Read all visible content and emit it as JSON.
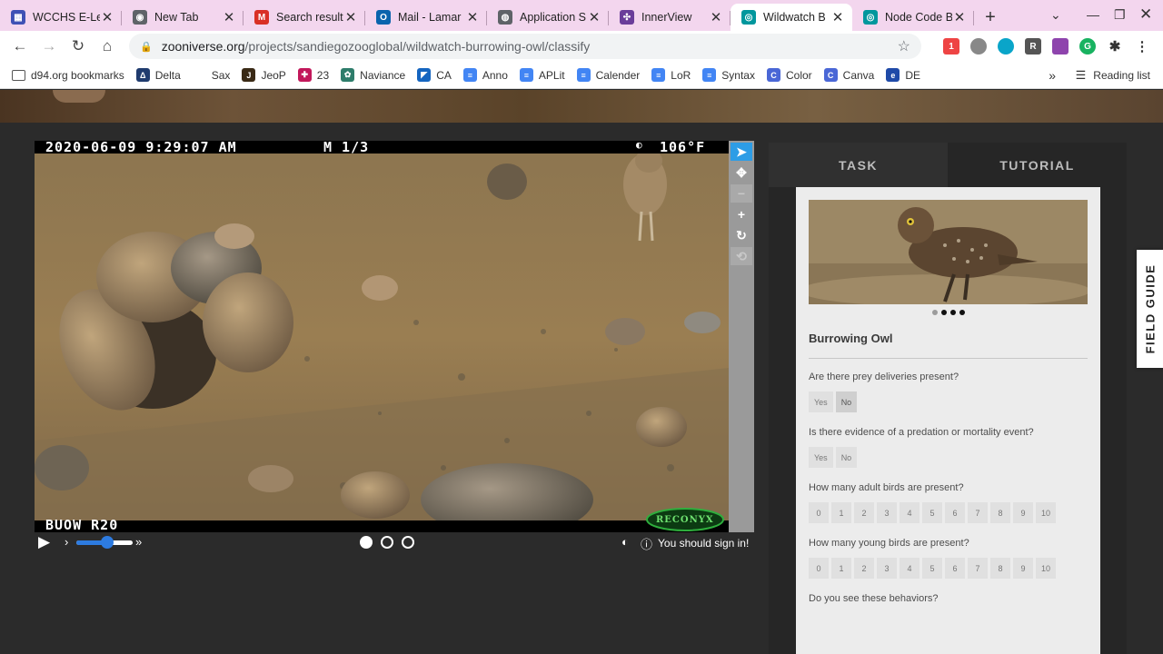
{
  "browser": {
    "tabs": [
      {
        "title": "WCCHS E-Le",
        "icon": "calendar-icon",
        "color": "#3f51b5"
      },
      {
        "title": "New Tab",
        "icon": "chrome-icon",
        "color": "#5f6368"
      },
      {
        "title": "Search result",
        "icon": "gmail-icon",
        "color": "#d93025"
      },
      {
        "title": "Mail - Lamar",
        "icon": "outlook-icon",
        "color": "#0a64ad"
      },
      {
        "title": "Application S",
        "icon": "globe-icon",
        "color": "#5f6368"
      },
      {
        "title": "InnerView",
        "icon": "innerview-icon",
        "color": "#6a3d9a"
      },
      {
        "title": "Wildwatch B",
        "icon": "zooniverse-icon",
        "color": "#00979d",
        "active": true
      },
      {
        "title": "Node Code B",
        "icon": "zooniverse-icon",
        "color": "#00979d"
      }
    ],
    "url_host": "zooniverse.org",
    "url_path": "/projects/sandiegozooglobal/wildwatch-burrowing-owl/classify",
    "bookmarks": [
      {
        "label": "d94.org bookmarks",
        "icon": "folder-icon",
        "color": "#555555"
      },
      {
        "label": "Delta",
        "icon": "delta-icon",
        "color": "#1f3b6e"
      },
      {
        "label": "Sax",
        "icon": "blank-icon",
        "color": "#ffffff"
      },
      {
        "label": "JeoP",
        "icon": "jeopardy-icon",
        "color": "#3a2a16"
      },
      {
        "label": "23",
        "icon": "23andme-icon",
        "color": "#c2185b"
      },
      {
        "label": "Naviance",
        "icon": "naviance-icon",
        "color": "#2e7d6b"
      },
      {
        "label": "CA",
        "icon": "commonapp-icon",
        "color": "#1565c0"
      },
      {
        "label": "Anno",
        "icon": "docs-icon",
        "color": "#4285f4"
      },
      {
        "label": "APLit",
        "icon": "docs-icon",
        "color": "#4285f4"
      },
      {
        "label": "Calender",
        "icon": "docs-icon",
        "color": "#4285f4"
      },
      {
        "label": "LoR",
        "icon": "docs-icon",
        "color": "#4285f4"
      },
      {
        "label": "Syntax",
        "icon": "docs-icon",
        "color": "#4285f4"
      },
      {
        "label": "Color",
        "icon": "canva-icon",
        "color": "#4a67d6"
      },
      {
        "label": "Canva",
        "icon": "canva-icon",
        "color": "#4a67d6"
      },
      {
        "label": "DE",
        "icon": "edge-icon",
        "color": "#1f4aa8"
      }
    ],
    "overflow": "»",
    "reading_list": "Reading list"
  },
  "viewer": {
    "timestamp": "2020-06-09 9:29:07 AM",
    "frame": "M 1/3",
    "temperature": "106°F",
    "camera_label": "BUOW R20",
    "brand": "RECONYX",
    "sign_in": "You should sign in!",
    "frame_count": 3,
    "playback_speed": 0.55
  },
  "panel": {
    "tabs": [
      "TASK",
      "TUTORIAL"
    ],
    "species": "Burrowing Owl",
    "questions": [
      {
        "text": "Are there prey deliveries present?",
        "options": [
          "Yes",
          "No"
        ],
        "selected": "No"
      },
      {
        "text": "Is there evidence of a predation or mortality event?",
        "options": [
          "Yes",
          "No"
        ],
        "selected": null
      },
      {
        "text": "How many adult birds are present?",
        "options": [
          "0",
          "1",
          "2",
          "3",
          "4",
          "5",
          "6",
          "7",
          "8",
          "9",
          "10"
        ],
        "selected": null
      },
      {
        "text": "How many young birds are present?",
        "options": [
          "0",
          "1",
          "2",
          "3",
          "4",
          "5",
          "6",
          "7",
          "8",
          "9",
          "10"
        ],
        "selected": null
      },
      {
        "text": "Do you see these behaviors?",
        "options": [],
        "selected": null
      }
    ],
    "field_guide": "FIELD GUIDE"
  }
}
